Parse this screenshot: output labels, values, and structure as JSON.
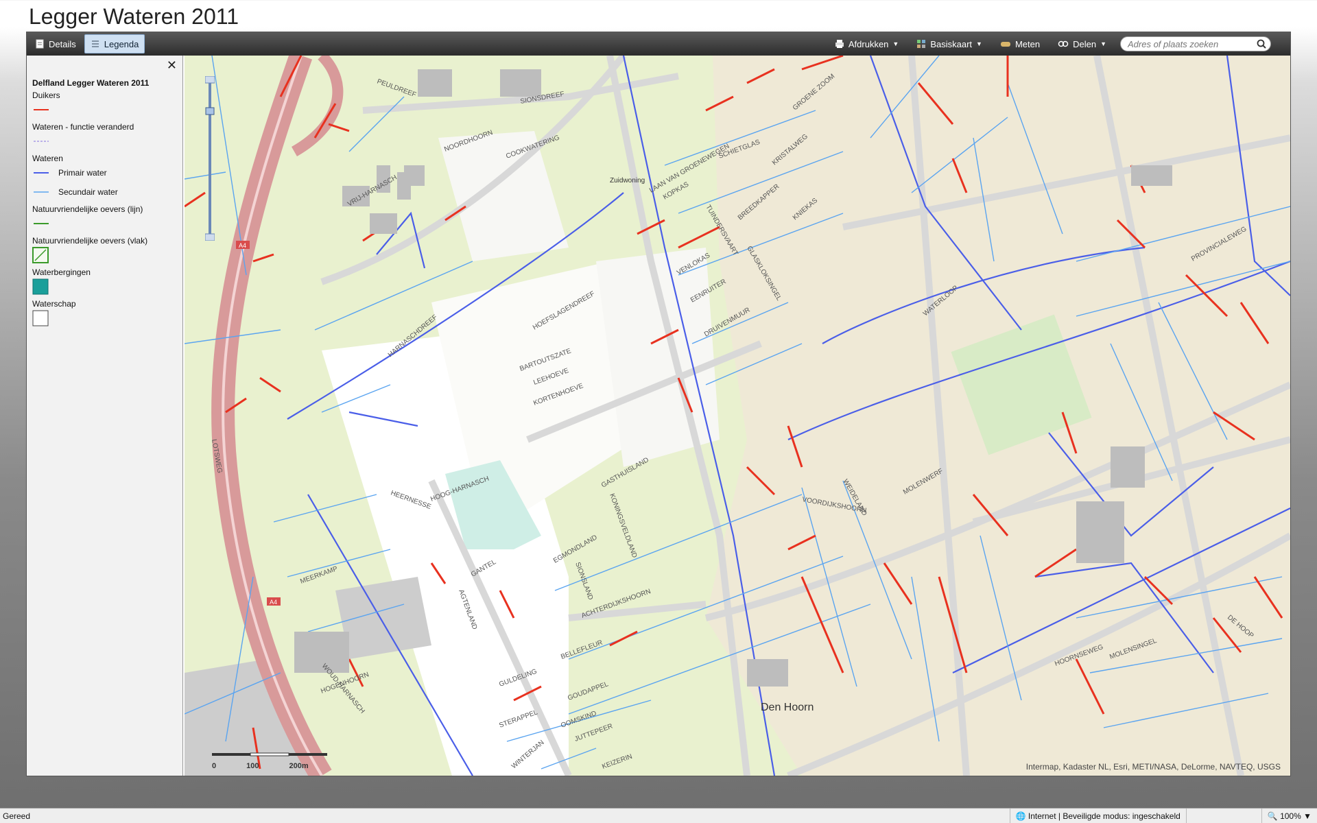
{
  "page_title": "Legger Wateren 2011",
  "toolbar": {
    "details_label": "Details",
    "legenda_label": "Legenda",
    "print_label": "Afdrukken",
    "basemap_label": "Basiskaart",
    "measure_label": "Meten",
    "share_label": "Delen",
    "search_placeholder": "Adres of plaats zoeken"
  },
  "legend": {
    "close_symbol": "✕",
    "title": "Delfland Legger Wateren 2011",
    "duikers": "Duikers",
    "wateren_functie": "Wateren - functie veranderd",
    "wateren": "Wateren",
    "primair": "Primair water",
    "secundair": "Secundair water",
    "oevers_lijn": "Natuurvriendelijke oevers (lijn)",
    "oevers_vlak": "Natuurvriendelijke oevers (vlak)",
    "waterbergingen": "Waterbergingen",
    "waterschap": "Waterschap"
  },
  "colors": {
    "duiker": "#e8311f",
    "primair": "#4a5ee8",
    "secundair": "#5aa4f0",
    "oever": "#3a9a2a",
    "waterberging": "#1a9f9a",
    "land_green": "#e9f1cf",
    "urban": "#efe9d6",
    "road": "#d8d8d8",
    "highway": "#d89a9a"
  },
  "map_labels": [
    "PEULDREEF",
    "SIONSDREEF",
    "NOORDHOORN",
    "VRIJ-HARNASCH",
    "COOKWATERING",
    "Zuidwoning",
    "LAAN VAN GROENEWEGEN",
    "GROENE ZOOM",
    "SCHIETGLAS",
    "KRISTALWEG",
    "KOPKAS",
    "TUINDERSVAART",
    "BREEDKAPPER",
    "GLASKLOKSINGEL",
    "KNIEKAS",
    "VENLOKAS",
    "EENRUITER",
    "DRUIVENMUUR",
    "HOEFSLAGENDREEF",
    "BARTOUTSZATE",
    "LEEHOEVE",
    "KORTENHOEVE",
    "HARNASCHDREEF",
    "HEERNESSE",
    "HOOG-HARNASCH",
    "GASTHUISLAND",
    "KONINGSVELDLAND",
    "EGMONDLAND",
    "GANTEL",
    "SIONSLAND",
    "AGTENLAND",
    "ACHTERDIJKSHOORN",
    "BELLEFLEUR",
    "GOUDAPPEL",
    "OOMSKIND",
    "JUTTEPEER",
    "KEIZERIN",
    "WINTERJAN",
    "STERAPPEL",
    "GULDELING",
    "MEERKAMP",
    "HOGENHOORN",
    "LOTSWEG",
    "WOUD-HARNASCH",
    "VOORDIJKSHOORN",
    "MOLENWERF",
    "WEIDELAND",
    "WATERLOOP",
    "PROVINCIALEWEG",
    "HOORNSEWEG",
    "MOLENSINGEL",
    "DE HOOP",
    "Den Hoorn",
    "A4"
  ],
  "scalebar": {
    "labels": [
      "0",
      "100",
      "200m"
    ]
  },
  "attribution": "Intermap, Kadaster NL, Esri, METI/NASA, DeLorme, NAVTEQ, USGS",
  "statusbar": {
    "left": "Gereed",
    "zone": "Internet | Beveiligde modus: ingeschakeld",
    "zoom": "100%"
  }
}
